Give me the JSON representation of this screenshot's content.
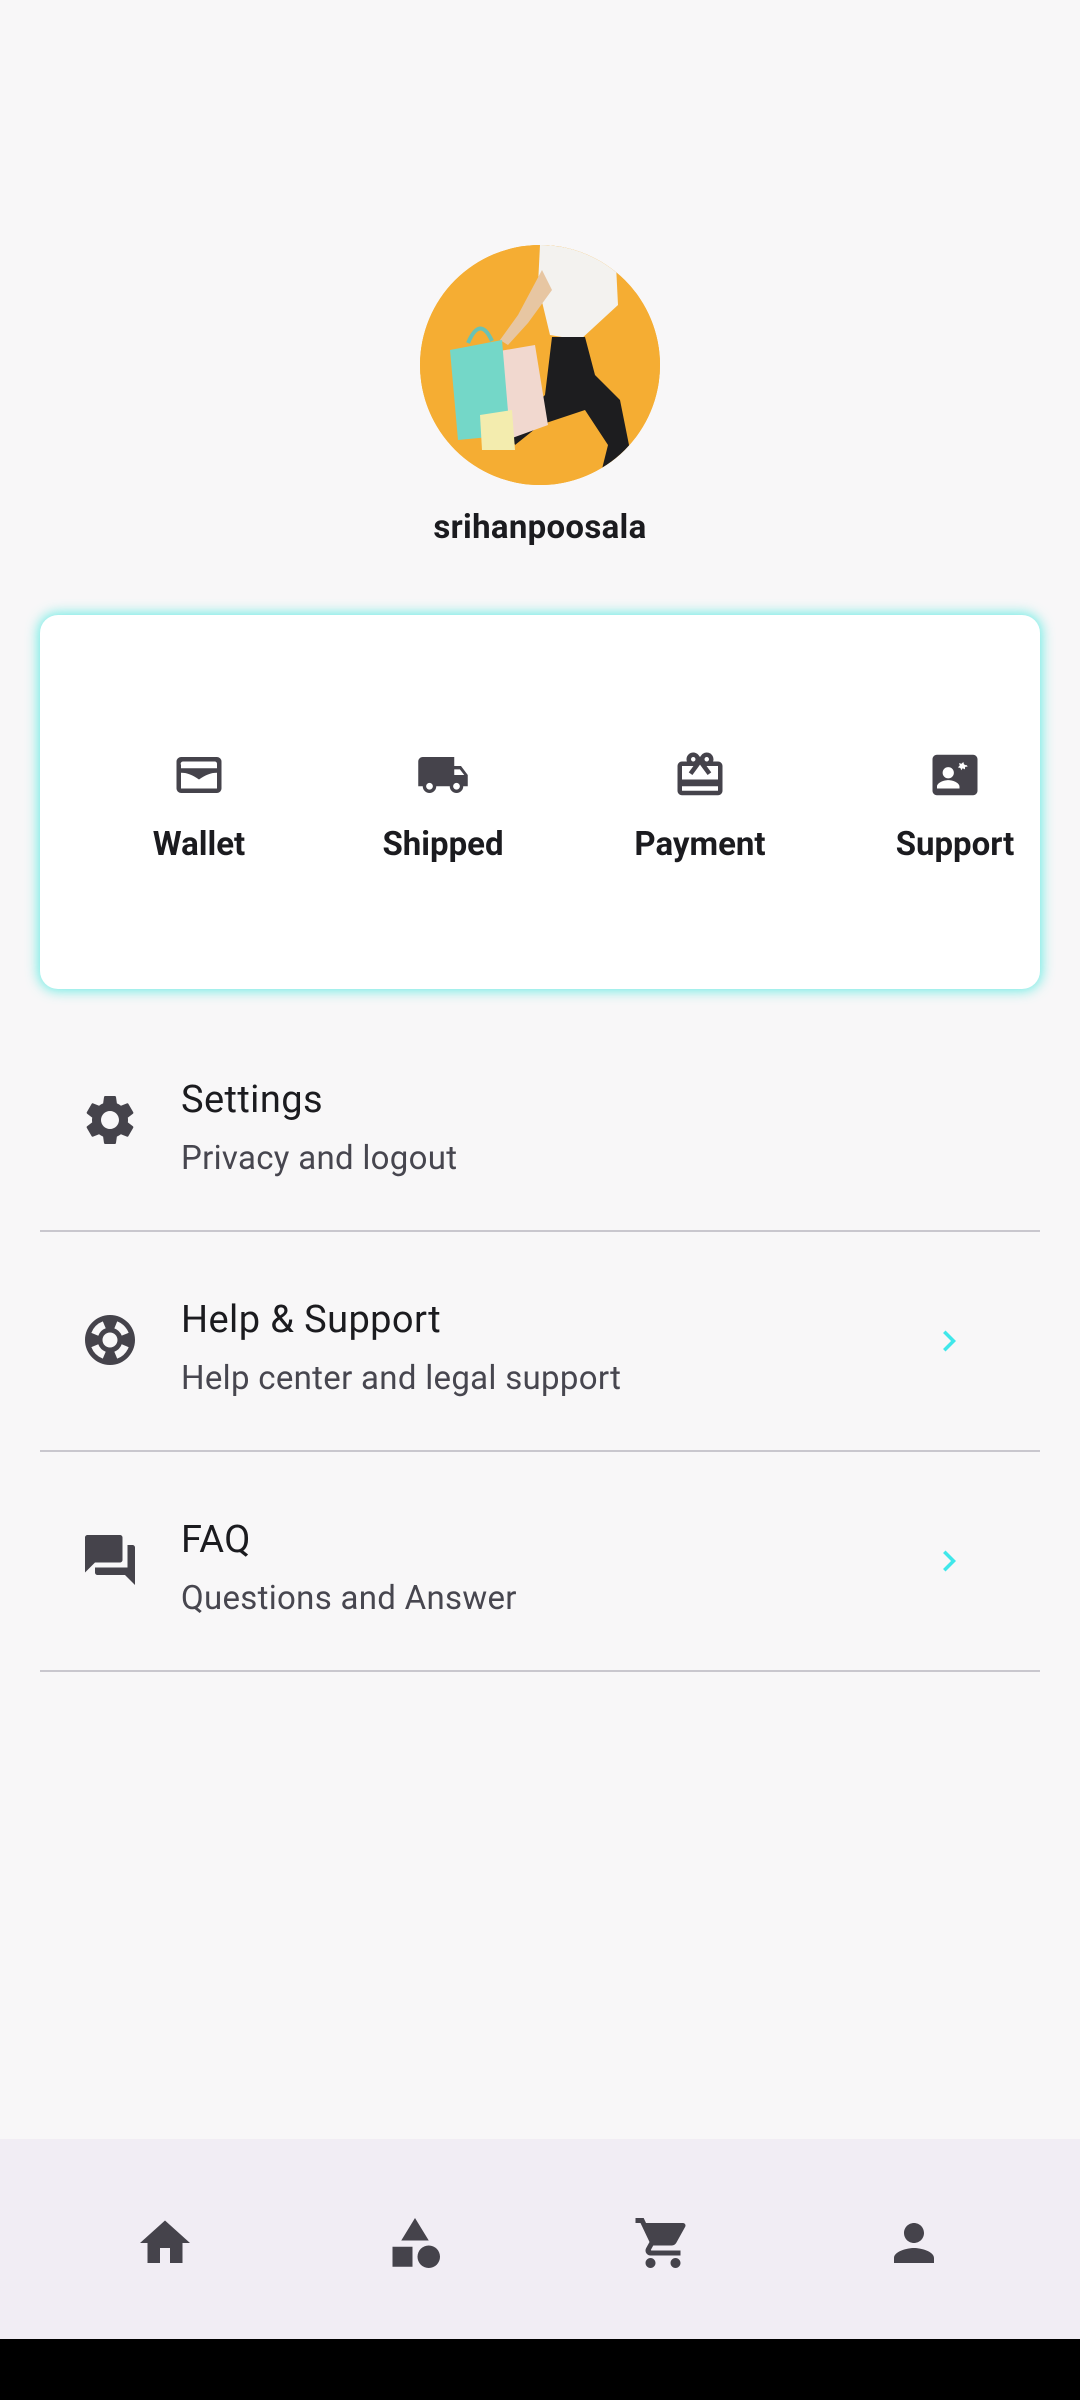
{
  "profile": {
    "username": "srihanpoosala",
    "avatar_icon": "shopper-photo"
  },
  "quick_actions": [
    {
      "label": "Wallet",
      "icon": "wallet-icon"
    },
    {
      "label": "Shipped",
      "icon": "truck-icon"
    },
    {
      "label": "Payment",
      "icon": "gift-card-icon"
    },
    {
      "label": "Support",
      "icon": "contact-card-icon"
    }
  ],
  "menu": [
    {
      "title": "Settings",
      "subtitle": "Privacy and logout",
      "icon": "gear-icon",
      "has_chevron": false
    },
    {
      "title": "Help & Support",
      "subtitle": "Help center and legal support",
      "icon": "lifebuoy-icon",
      "has_chevron": true
    },
    {
      "title": "FAQ",
      "subtitle": "Questions and Answer",
      "icon": "forum-icon",
      "has_chevron": true
    }
  ],
  "bottom_nav": [
    {
      "icon": "home-icon"
    },
    {
      "icon": "categories-icon"
    },
    {
      "icon": "cart-icon"
    },
    {
      "icon": "person-icon"
    }
  ],
  "colors": {
    "accent": "#40e7ea",
    "card_glow": "#40e8de",
    "icon": "#45434b",
    "text": "#1b1b1f",
    "background": "#f8f7f8",
    "nav_background": "#f1edf4"
  }
}
